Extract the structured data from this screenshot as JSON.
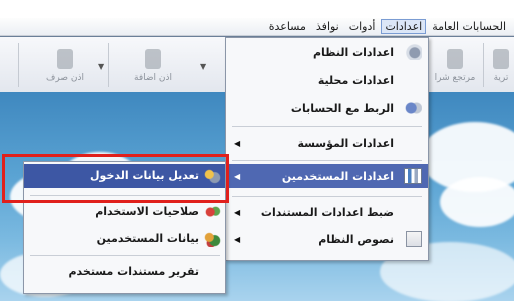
{
  "menubar": {
    "items": [
      "الحسابات العامة",
      "اعدادات",
      "أدوات",
      "نوافذ",
      "مساعدة"
    ],
    "active_index": 1
  },
  "toolbar": {
    "left_buttons": [
      "اذن صرف",
      "اذن اضافة"
    ],
    "right_buttons": [
      "مرتجع شرا",
      "ترية"
    ]
  },
  "settings_menu": {
    "items": [
      {
        "label": "اعدادات النظام",
        "icon": "system-settings-icon",
        "submenu": false
      },
      {
        "label": "اعدادات محلية",
        "icon": "",
        "submenu": false
      },
      {
        "label": "الربط مع الحسابات",
        "icon": "accounts-link-icon",
        "submenu": false
      },
      {
        "label": "اعدادات المؤسسة",
        "icon": "",
        "submenu": true
      },
      {
        "label": "اعدادات المستخدمين",
        "icon": "users-settings-icon",
        "submenu": true,
        "highlighted": true
      },
      {
        "label": "ضبط اعدادات المستندات",
        "icon": "",
        "submenu": true
      },
      {
        "label": "نصوص النظام",
        "icon": "system-texts-icon",
        "submenu": true
      }
    ]
  },
  "users_submenu": {
    "items": [
      {
        "label": "تعديل بيانات الدخول",
        "icon": "edit-login-icon",
        "highlighted": true
      },
      {
        "label": "صلاحيات الاستخدام",
        "icon": "permissions-icon"
      },
      {
        "label": "بيانات المستخدمين",
        "icon": "users-data-icon"
      },
      {
        "label": "تقرير مستندات مستخدم",
        "icon": ""
      }
    ]
  },
  "colors": {
    "highlight": "#4f68b2",
    "annotation": "#e0201c"
  }
}
